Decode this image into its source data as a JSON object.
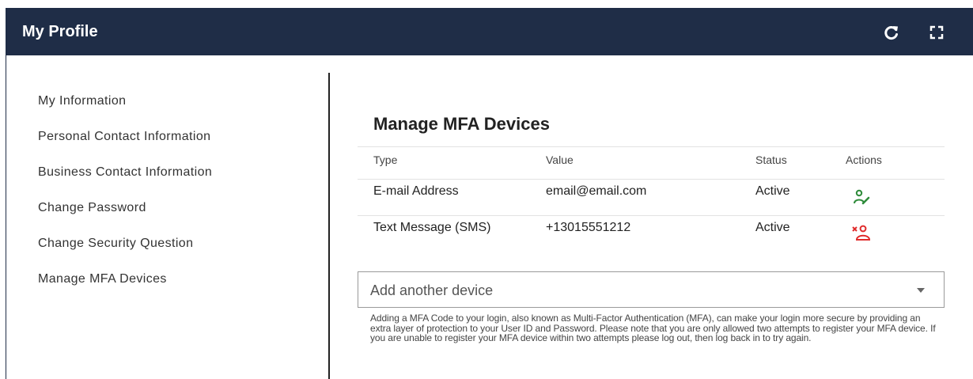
{
  "header": {
    "title": "My Profile",
    "refresh_icon": "refresh-icon",
    "fullscreen_icon": "fullscreen-icon",
    "background": "#1f2d47"
  },
  "sidebar": {
    "items": [
      {
        "label": "My Information"
      },
      {
        "label": "Personal Contact Information"
      },
      {
        "label": "Business Contact Information"
      },
      {
        "label": "Change Password"
      },
      {
        "label": "Change Security Question"
      },
      {
        "label": "Manage MFA Devices"
      }
    ]
  },
  "main": {
    "title": "Manage MFA Devices",
    "table": {
      "columns": [
        "Type",
        "Value",
        "Status",
        "Actions"
      ],
      "rows": [
        {
          "type": "E-mail Address",
          "value": "email@email.com",
          "status": "Active",
          "action_icon": "edit-user-icon",
          "action_color": "#2e8b3a"
        },
        {
          "type": "Text Message (SMS)",
          "value": "+13015551212",
          "status": "Active",
          "action_icon": "remove-user-icon",
          "action_color": "#e02b2b"
        }
      ]
    },
    "add_device": {
      "placeholder": "Add another device"
    },
    "help_text": "Adding a MFA Code to your login, also known as Multi-Factor Authentication (MFA), can make your login more secure by providing an extra layer of protection to your User ID and Password. Please note that you are only allowed two attempts to register your MFA device. If you are unable to register your MFA device within two attempts please log out, then log back in to try again."
  }
}
